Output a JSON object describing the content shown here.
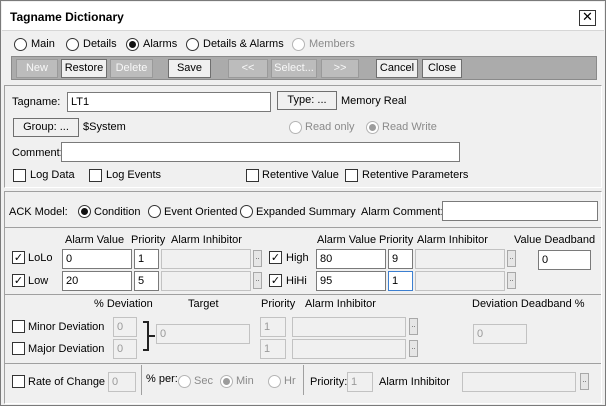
{
  "window": {
    "title": "Tagname Dictionary",
    "close_glyph": "✕"
  },
  "tabs": [
    {
      "label": "Main",
      "selected": false
    },
    {
      "label": "Details",
      "selected": false
    },
    {
      "label": "Alarms",
      "selected": true
    },
    {
      "label": "Details & Alarms",
      "selected": false
    },
    {
      "label": "Members",
      "selected": false,
      "disabled": true
    }
  ],
  "toolbar": {
    "new": "New",
    "restore": "Restore",
    "delete": "Delete",
    "save": "Save",
    "prev": "<<",
    "select": "Select...",
    "next": ">>",
    "cancel": "Cancel",
    "close": "Close"
  },
  "tag": {
    "tagname_label": "Tagname:",
    "tagname_value": "LT1",
    "type_button": "Type: ...",
    "type_value": "Memory Real",
    "group_button": "Group: ...",
    "group_value": "$System",
    "read_only": "Read only",
    "read_write": "Read Write",
    "comment_label": "Comment:",
    "comment_value": ""
  },
  "options": {
    "log_data": "Log Data",
    "log_events": "Log Events",
    "retentive_value": "Retentive Value",
    "retentive_params": "Retentive Parameters"
  },
  "ack": {
    "label": "ACK Model:",
    "condition": "Condition",
    "event_oriented": "Event Oriented",
    "expanded_summary": "Expanded Summary",
    "alarm_comment_label": "Alarm Comment:",
    "alarm_comment_value": ""
  },
  "limits": {
    "header_alarm_value": "Alarm Value",
    "header_priority": "Priority",
    "header_inhibitor": "Alarm Inhibitor",
    "header_deadband": "Value Deadband",
    "lolo": {
      "label": "LoLo",
      "value": "0",
      "priority": "1",
      "checked": true
    },
    "low": {
      "label": "Low",
      "value": "20",
      "priority": "5",
      "checked": true
    },
    "high": {
      "label": "High",
      "value": "80",
      "priority": "9",
      "checked": true
    },
    "hihi": {
      "label": "HiHi",
      "value": "95",
      "priority": "1",
      "checked": true
    },
    "deadband_value": "0",
    "ellipsis": ".."
  },
  "deviation": {
    "header_pct": "% Deviation",
    "header_target": "Target",
    "header_priority": "Priority",
    "header_inhibitor": "Alarm Inhibitor",
    "header_deadband": "Deviation Deadband %",
    "minor_label": "Minor Deviation",
    "minor_value": "0",
    "minor_priority": "1",
    "major_label": "Major Deviation",
    "major_value": "0",
    "major_priority": "1",
    "target_value": "0",
    "deadband_value": "0"
  },
  "roc": {
    "label": "Rate of Change",
    "value": "0",
    "per_label": "% per:",
    "sec": "Sec",
    "min": "Min",
    "hr": "Hr",
    "priority_label": "Priority:",
    "priority_value": "1",
    "inhibitor_label": "Alarm Inhibitor"
  },
  "glyphs": {
    "check": "✓"
  }
}
